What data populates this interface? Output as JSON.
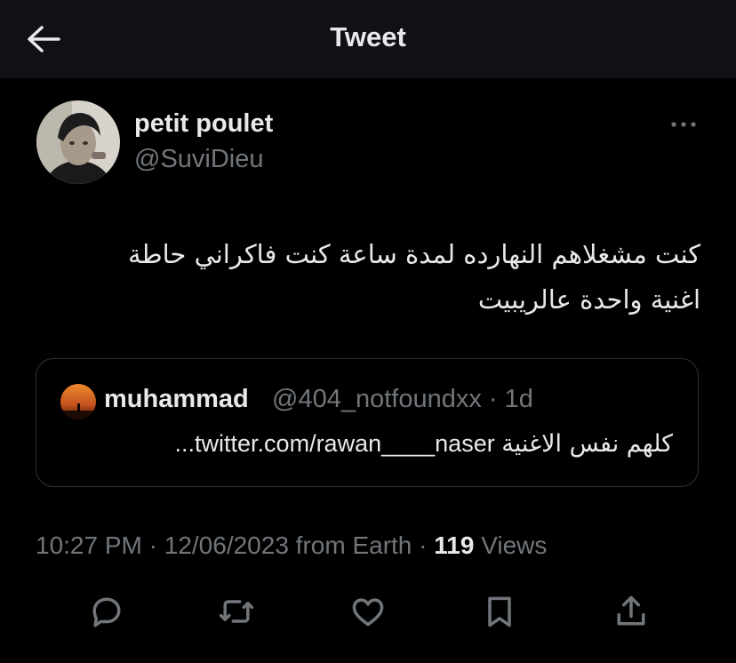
{
  "header": {
    "title": "Tweet",
    "back_icon": "arrow-left-icon"
  },
  "tweet": {
    "author": {
      "display_name": "petit poulet",
      "handle": "@SuviDieu"
    },
    "text_line1": "كنت مشغلاهم النهارده لمدة ساعة كنت فاكراني حاطة",
    "text_line2": "اغنية واحدة عالريبيت",
    "quote": {
      "name": "muhammad",
      "handle": "@404_notfoundxx",
      "separator": "·",
      "age": "1d",
      "text_arabic": "كلهم نفس الاغنية",
      "text_link": "...twitter.com/rawan____naser"
    },
    "meta": {
      "time": "10:27 PM",
      "sep1": "·",
      "date": "12/06/2023",
      "source": "from Earth",
      "sep2": "·",
      "views_count": "119",
      "views_label": "Views"
    }
  },
  "actions": [
    "reply-icon",
    "retweet-icon",
    "like-icon",
    "bookmark-icon",
    "share-icon"
  ],
  "colors": {
    "background": "#000000",
    "header_bg": "#101114",
    "text_primary": "#e7e9ea",
    "text_secondary": "#71767b",
    "border": "#2f3336"
  }
}
